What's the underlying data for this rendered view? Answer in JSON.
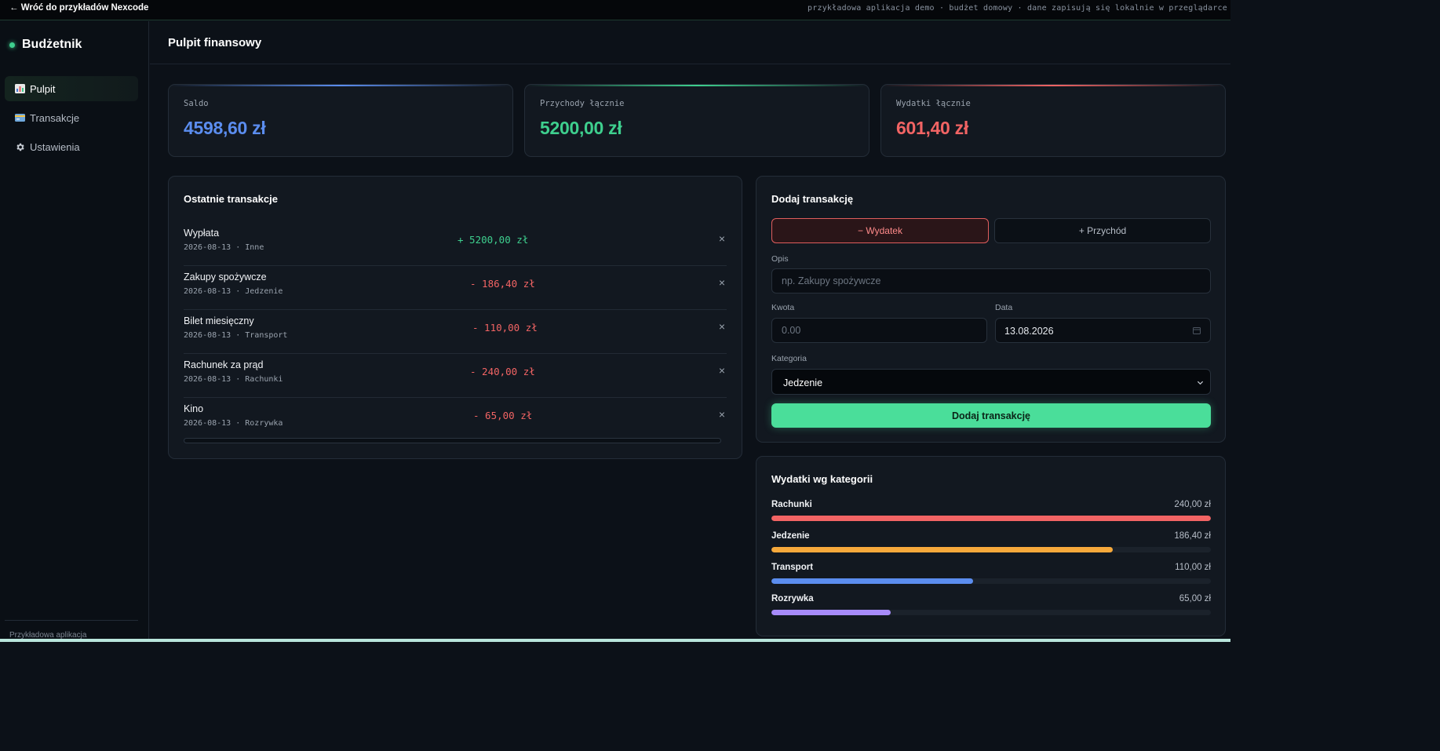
{
  "topbar": {
    "back_link": "← Wróć do przykładów Nexcode",
    "demo_note": "przykładowa aplikacja demo · budżet domowy · dane zapisują się lokalnie w przeglądarce"
  },
  "sidebar": {
    "brand": "Budżetnik",
    "items": [
      {
        "label": "Pulpit",
        "icon": "bar-chart-icon",
        "active": true
      },
      {
        "label": "Transakcje",
        "icon": "credit-card-icon",
        "active": false
      },
      {
        "label": "Ustawienia",
        "icon": "gear-icon",
        "active": false
      }
    ],
    "footer": "Przykładowa aplikacja"
  },
  "header": {
    "title": "Pulpit finansowy"
  },
  "stats": {
    "balance": {
      "label": "Saldo",
      "value": "4598,60 zł",
      "color": "#5b8def"
    },
    "income": {
      "label": "Przychody łącznie",
      "value": "5200,00 zł",
      "color": "#3ecf8e"
    },
    "expense": {
      "label": "Wydatki łącznie",
      "value": "601,40 zł",
      "color": "#f26464"
    }
  },
  "recent": {
    "title": "Ostatnie transakcje",
    "transactions": [
      {
        "name": "Wypłata",
        "date": "2026-08-13",
        "category": "Inne",
        "amount": "+ 5200,00 zł",
        "type": "income",
        "meta": "2026-08-13 · Inne"
      },
      {
        "name": "Zakupy spożywcze",
        "date": "2026-08-13",
        "category": "Jedzenie",
        "amount": "- 186,40 zł",
        "type": "expense",
        "meta": "2026-08-13 · Jedzenie"
      },
      {
        "name": "Bilet miesięczny",
        "date": "2026-08-13",
        "category": "Transport",
        "amount": "- 110,00 zł",
        "type": "expense",
        "meta": "2026-08-13 · Transport"
      },
      {
        "name": "Rachunek za prąd",
        "date": "2026-08-13",
        "category": "Rachunki",
        "amount": "- 240,00 zł",
        "type": "expense",
        "meta": "2026-08-13 · Rachunki"
      },
      {
        "name": "Kino",
        "date": "2026-08-13",
        "category": "Rozrywka",
        "amount": "- 65,00 zł",
        "type": "expense",
        "meta": "2026-08-13 · Rozrywka"
      }
    ]
  },
  "form": {
    "title": "Dodaj transakcję",
    "expense_button": "− Wydatek",
    "income_button": "+ Przychód",
    "selected_type": "expense",
    "desc_label": "Opis",
    "desc_placeholder": "np. Zakupy spożywcze",
    "amount_label": "Kwota",
    "amount_placeholder": "0.00",
    "date_label": "Data",
    "date_value": "13.08.2026",
    "category_label": "Kategoria",
    "category_value": "Jedzenie",
    "submit_label": "Dodaj transakcję"
  },
  "categories": {
    "title": "Wydatki wg kategorii",
    "items": [
      {
        "name": "Rachunki",
        "amount": "240,00 zł",
        "share": 1.0,
        "color": "#f26464"
      },
      {
        "name": "Jedzenie",
        "amount": "186,40 zł",
        "share": 0.7767,
        "color": "#f6a93b"
      },
      {
        "name": "Transport",
        "amount": "110,00 zł",
        "share": 0.4583,
        "color": "#5b8def"
      },
      {
        "name": "Rozrywka",
        "amount": "65,00 zł",
        "share": 0.2708,
        "color": "#a78bfa"
      }
    ]
  },
  "colors": {
    "income": "#3ecf8e",
    "expense": "#f26464",
    "accent": "#4ade9a"
  }
}
